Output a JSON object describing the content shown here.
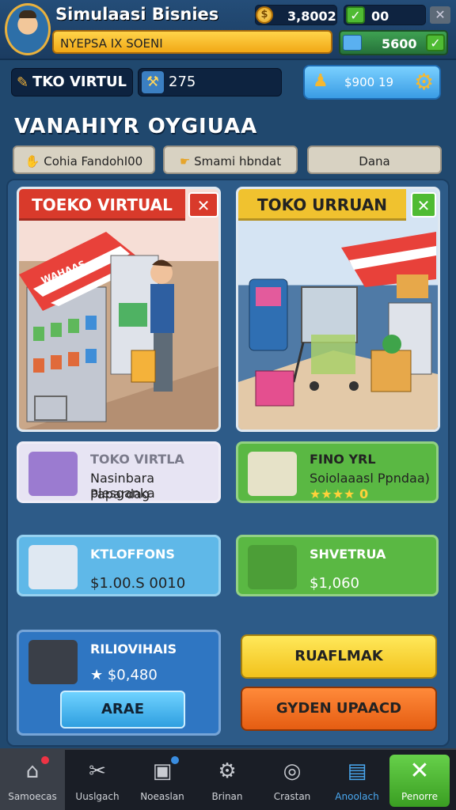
{
  "header": {
    "title": "Simulaasi Bisnies",
    "subtitle": "NYEPSA IX SOENI",
    "coins": "3,8002",
    "checks": "00",
    "cash": "5600",
    "close_icon": "close-icon"
  },
  "toolbar": {
    "shop_name": "TKO VIRTUL",
    "counter": "275",
    "price": "$900 19"
  },
  "section_title": "VANAHIYR OYGIUAA",
  "tabs": [
    "Cohia FandohI00",
    "Smami hbndat",
    "Dana"
  ],
  "scenes": [
    {
      "banner": "TOEKO VIRTUAL",
      "color": "#d93a2b",
      "sign": "WAHAAS"
    },
    {
      "banner": "TOKO URRUAN",
      "color": "#f0c22f"
    }
  ],
  "cards": [
    {
      "title": "TOKO VIRTLA",
      "line1": "Nasinbara plesganka",
      "line2": "Papardag"
    },
    {
      "title": "FINO YRL",
      "line1": "Soiolaaasl Ppndaa)",
      "rating": "★★★★ 0"
    },
    {
      "title": "KTLOFFONS",
      "value": "$1.00.S 0010"
    },
    {
      "title": "SHVETRUA",
      "value": "$1,060"
    },
    {
      "title": "RILIOVIHAIS",
      "value": "★ $0,480",
      "button": "ARAE"
    }
  ],
  "buttons": {
    "yellow": "RUAFLMAK",
    "orange": "GYDEN UPAACD"
  },
  "nav": [
    {
      "label": "Samoecas",
      "icon": "house-icon",
      "badge": "1"
    },
    {
      "label": "Uuslgach",
      "icon": "tools-icon"
    },
    {
      "label": "Noeaslan",
      "icon": "monitor-icon",
      "badge": "3"
    },
    {
      "label": "Brinan",
      "icon": "gear-icon"
    },
    {
      "label": "Crastan",
      "icon": "compass-icon"
    },
    {
      "label": "Anoolach",
      "icon": "document-icon"
    },
    {
      "label": "Penorre",
      "icon": "close-icon"
    }
  ]
}
